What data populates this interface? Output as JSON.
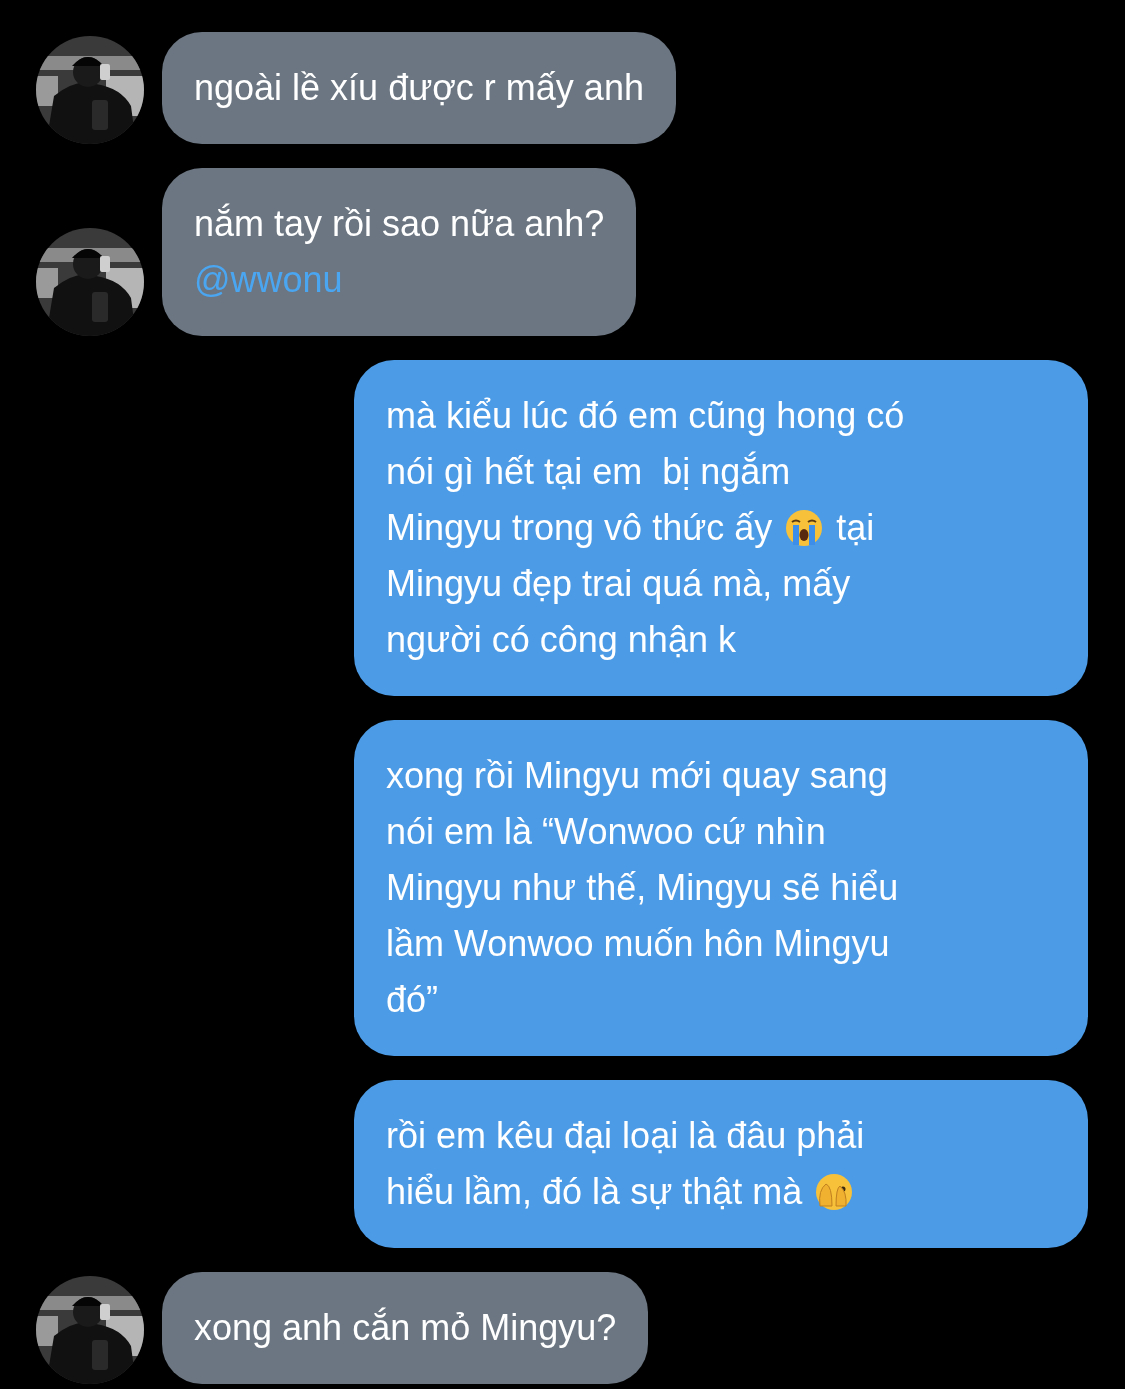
{
  "messages": [
    {
      "kind": "incoming",
      "avatar": {
        "kind": "picture"
      },
      "lines": [
        [
          {
            "kind": "text",
            "text": "ngoài lề xíu được r mấy anh"
          }
        ]
      ]
    },
    {
      "kind": "incoming",
      "avatar": {
        "kind": "picture"
      },
      "lines": [
        [
          {
            "kind": "text",
            "text": "nắm tay rồi sao nữa anh?"
          }
        ],
        [
          {
            "kind": "mention",
            "text": "@wwonu"
          }
        ]
      ]
    },
    {
      "kind": "outgoing",
      "lines": [
        [
          {
            "kind": "text",
            "text": "mà kiểu lúc đó em cũng hong có"
          }
        ],
        [
          {
            "kind": "text",
            "text": "nói gì hết tại em  bị ngắm"
          }
        ],
        [
          {
            "kind": "text",
            "text": "Mingyu trong vô thức ấy"
          },
          {
            "kind": "sob"
          },
          {
            "kind": "text",
            "text": "tại"
          }
        ],
        [
          {
            "kind": "text",
            "text": "Mingyu đẹp trai quá mà, mấy"
          }
        ],
        [
          {
            "kind": "text",
            "text": "người có công nhận k"
          }
        ]
      ]
    },
    {
      "kind": "outgoing",
      "lines": [
        [
          {
            "kind": "text",
            "text": "xong rồi Mingyu mới quay sang"
          }
        ],
        [
          {
            "kind": "text",
            "text": "nói em là “Wonwoo cứ nhìn"
          }
        ],
        [
          {
            "kind": "text",
            "text": "Mingyu như thế, Mingyu sẽ hiểu"
          }
        ],
        [
          {
            "kind": "text",
            "text": "lầm Wonwoo muốn hôn Mingyu"
          }
        ],
        [
          {
            "kind": "text",
            "text": "đó”"
          }
        ]
      ]
    },
    {
      "kind": "outgoing",
      "lines": [
        [
          {
            "kind": "text",
            "text": "rồi em kêu đại loại là đâu phải"
          }
        ],
        [
          {
            "kind": "text",
            "text": "hiểu lầm, đó là sự thật mà"
          },
          {
            "kind": "peek"
          }
        ]
      ]
    },
    {
      "kind": "incoming",
      "avatar": {
        "kind": "picture"
      },
      "lines": [
        [
          {
            "kind": "text",
            "text": "xong anh cắn mỏ Mingyu?"
          }
        ]
      ]
    }
  ]
}
